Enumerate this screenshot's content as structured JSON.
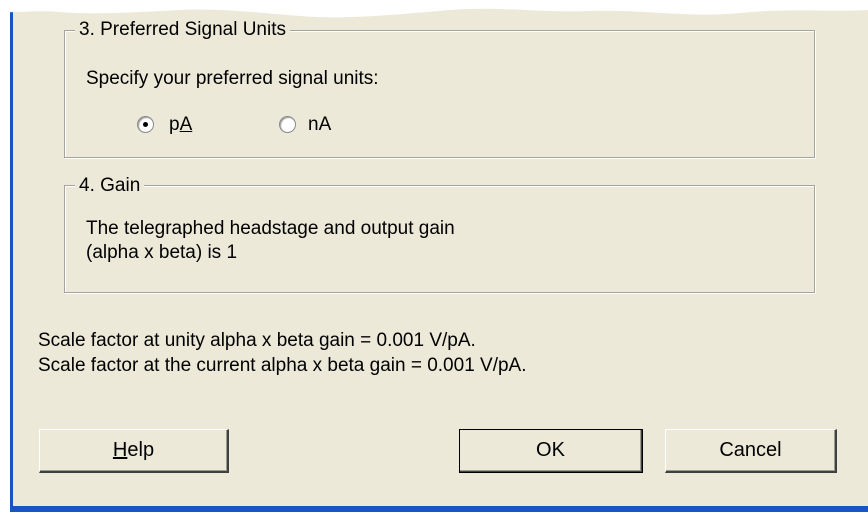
{
  "units_group": {
    "legend": "3. Preferred Signal Units",
    "prompt": "Specify your preferred signal units:",
    "options": [
      {
        "label_pre": "p",
        "label_accel": "A",
        "selected": true
      },
      {
        "label": "nA",
        "selected": false
      }
    ]
  },
  "gain_group": {
    "legend": "4. Gain",
    "line1": "The telegraphed headstage and output gain",
    "line2": "(alpha x beta) is 1"
  },
  "scale": {
    "line1": "Scale factor at unity alpha x beta gain = 0.001 V/pA.",
    "line2": "Scale factor at the current alpha x beta gain = 0.001 V/pA."
  },
  "buttons": {
    "help_accel": "H",
    "help_rest": "elp",
    "ok": "OK",
    "cancel": "Cancel"
  },
  "colors": {
    "dialog_bg": "#ece9d8",
    "frame_blue": "#1c54c4"
  }
}
